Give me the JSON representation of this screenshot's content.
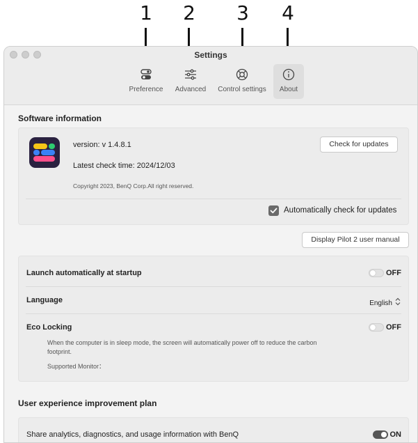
{
  "callouts": [
    "1",
    "2",
    "3",
    "4"
  ],
  "window": {
    "title": "Settings"
  },
  "toolbar": {
    "items": [
      {
        "label": "Preference",
        "icon": "toggle-icon"
      },
      {
        "label": "Advanced",
        "icon": "sliders-icon"
      },
      {
        "label": "Control settings",
        "icon": "lifebuoy-icon"
      },
      {
        "label": "About",
        "icon": "info-icon",
        "active": true
      }
    ]
  },
  "software": {
    "section_title": "Software information",
    "version": "version: v 1.4.8.1",
    "latest_check": "Latest check time: 2024/12/03",
    "copyright": "Copyright  2023, BenQ Corp.All right reserved.",
    "check_button": "Check for updates",
    "auto_check_label": "Automatically check for updates",
    "auto_check": true
  },
  "manual_button": "Display Pilot 2 user manual",
  "settings": {
    "launch_label": "Launch automatically at startup",
    "launch_state": "OFF",
    "language_label": "Language",
    "language_value": "English",
    "eco_label": "Eco Locking",
    "eco_state": "OFF",
    "eco_desc_1": "When the computer is in sleep mode, the screen will automatically power off to reduce the carbon",
    "eco_desc_2": "footprint.",
    "eco_supported": "Supported Monitor："
  },
  "ux": {
    "section_title": "User experience improvement plan",
    "share_label": "Share analytics, diagnostics, and usage information with BenQ",
    "share_state": "ON"
  },
  "colors": {
    "icon_bg": "#2a2140",
    "icon_yellow": "#f5c518",
    "icon_green": "#2ecc71",
    "icon_blue": "#3b82f6",
    "icon_pink": "#ff4f8b"
  }
}
